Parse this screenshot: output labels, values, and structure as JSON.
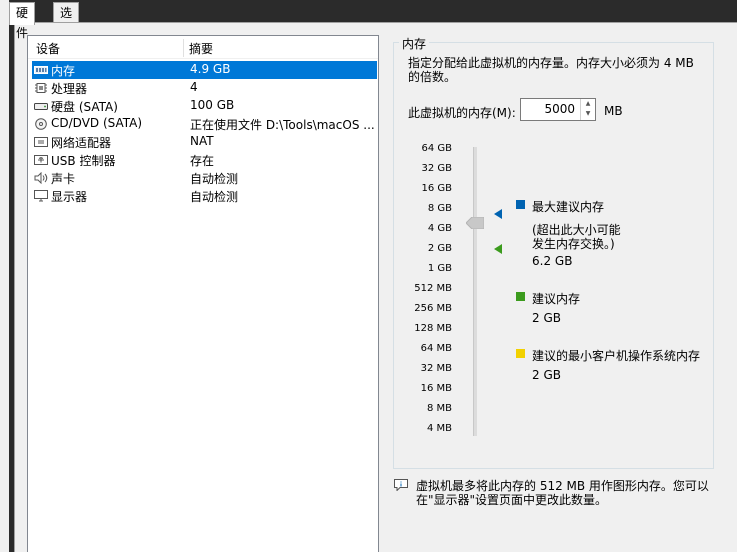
{
  "tabs": [
    {
      "label": "硬件",
      "active": true
    },
    {
      "label": "选项",
      "active": false
    }
  ],
  "device_table": {
    "headers": {
      "device": "设备",
      "summary": "摘要"
    },
    "rows": [
      {
        "device": "内存",
        "summary": "4.9 GB",
        "icon": "memory-icon",
        "selected": true
      },
      {
        "device": "处理器",
        "summary": "4",
        "icon": "cpu-icon",
        "selected": false
      },
      {
        "device": "硬盘 (SATA)",
        "summary": "100 GB",
        "icon": "hard-disk-icon",
        "selected": false
      },
      {
        "device": "CD/DVD (SATA)",
        "summary": "正在使用文件 D:\\Tools\\macOS ...",
        "icon": "cd-dvd-icon",
        "selected": false
      },
      {
        "device": "网络适配器",
        "summary": "NAT",
        "icon": "network-adapter-icon",
        "selected": false
      },
      {
        "device": "USB 控制器",
        "summary": "存在",
        "icon": "usb-icon",
        "selected": false
      },
      {
        "device": "声卡",
        "summary": "自动检测",
        "icon": "speaker-icon",
        "selected": false
      },
      {
        "device": "显示器",
        "summary": "自动检测",
        "icon": "monitor-icon",
        "selected": false
      }
    ]
  },
  "memory_panel": {
    "group_title": "内存",
    "description": "指定分配给此虚拟机的内存量。内存大小必须为 4 MB 的倍数。",
    "memory_label": "此虚拟机的内存(M):",
    "memory_value": "5000",
    "unit": "MB",
    "scale_ticks": [
      "64 GB",
      "32 GB",
      "16 GB",
      "8 GB",
      "4 GB",
      "2 GB",
      "1 GB",
      "512 MB",
      "256 MB",
      "128 MB",
      "64 MB",
      "32 MB",
      "16 MB",
      "8 MB",
      "4 MB"
    ],
    "legend": {
      "max_recommended": {
        "title": "最大建议内存",
        "note_line1": "(超出此大小可能",
        "note_line2": "发生内存交换。)",
        "value": "6.2 GB",
        "color": "#0063b1"
      },
      "recommended": {
        "title": "建议内存",
        "value": "2 GB",
        "color": "#3b9b1d"
      },
      "guest_min": {
        "title": "建议的最小客户机操作系统内存",
        "value": "2 GB",
        "color": "#f2d100"
      }
    }
  },
  "info_note": {
    "line1": "虚拟机最多将此内存的 512 MB 用作图形内存。您可以",
    "line2": "在\"显示器\"设置页面中更改此数量。"
  }
}
